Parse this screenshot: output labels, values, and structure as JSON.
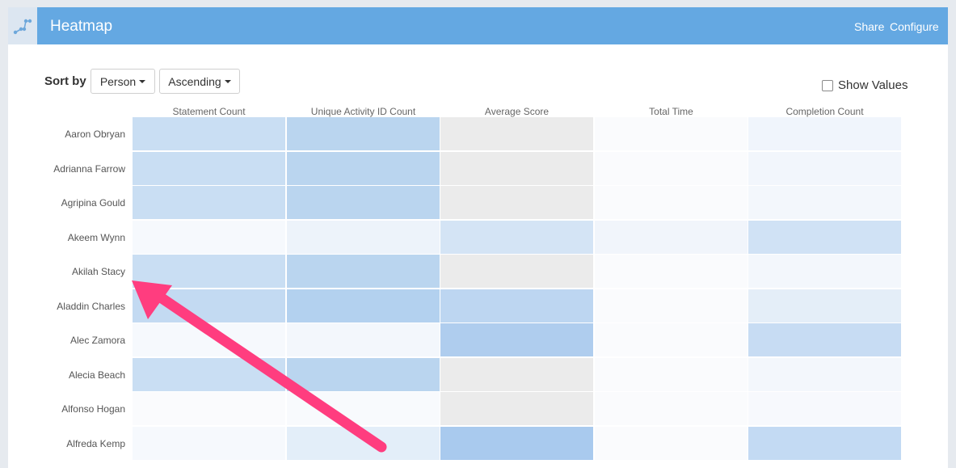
{
  "header": {
    "title": "Heatmap",
    "share_label": "Share",
    "configure_label": "Configure",
    "logo_icon": "graph-line-icon",
    "background_color": "#64a8e2"
  },
  "controls": {
    "sort_by_label": "Sort by",
    "sort_field": "Person",
    "sort_order": "Ascending",
    "show_values_label": "Show Values",
    "show_values_checked": false
  },
  "heatmap": {
    "columns": [
      "Statement Count",
      "Unique Activity ID Count",
      "Average Score",
      "Total Time",
      "Completion Count"
    ],
    "rows": [
      {
        "name": "Aaron Obryan",
        "cells": [
          "#c9def3",
          "#bad5ef",
          "#ebebeb",
          "#fafbfd",
          "#f0f5fc"
        ]
      },
      {
        "name": "Adrianna Farrow",
        "cells": [
          "#c9def3",
          "#bad5ef",
          "#ebebeb",
          "#fafbfd",
          "#f2f6fc"
        ]
      },
      {
        "name": "Agripina Gould",
        "cells": [
          "#c9def3",
          "#bad5ef",
          "#ebebeb",
          "#fafbfd",
          "#f3f7fc"
        ]
      },
      {
        "name": "Akeem Wynn",
        "cells": [
          "#f6f9fd",
          "#edf3fa",
          "#d4e4f5",
          "#f1f5fb",
          "#d0e2f5"
        ]
      },
      {
        "name": "Akilah Stacy",
        "cells": [
          "#c9def3",
          "#bad5ef",
          "#ebebeb",
          "#fafbfd",
          "#f3f7fc"
        ]
      },
      {
        "name": "Aladdin Charles",
        "cells": [
          "#c3daf2",
          "#b3d1ef",
          "#bdd6f1",
          "#fafbfd",
          "#e4eef8"
        ]
      },
      {
        "name": "Alec Zamora",
        "cells": [
          "#f6f9fd",
          "#f3f7fc",
          "#afcdee",
          "#fafbfd",
          "#c7dcf3"
        ]
      },
      {
        "name": "Alecia Beach",
        "cells": [
          "#c9def3",
          "#bad5ef",
          "#ebebeb",
          "#fafbfd",
          "#f3f7fc"
        ]
      },
      {
        "name": "Alfonso Hogan",
        "cells": [
          "#fafbfd",
          "#f8fafd",
          "#ebebeb",
          "#fafbfd",
          "#f7f9fd"
        ]
      },
      {
        "name": "Alfreda Kemp",
        "cells": [
          "#f6f9fd",
          "#e3eef9",
          "#a9caee",
          "#fafbfd",
          "#c3daf3"
        ]
      }
    ]
  },
  "annotation": {
    "arrow_color": "#ff3d7f"
  }
}
